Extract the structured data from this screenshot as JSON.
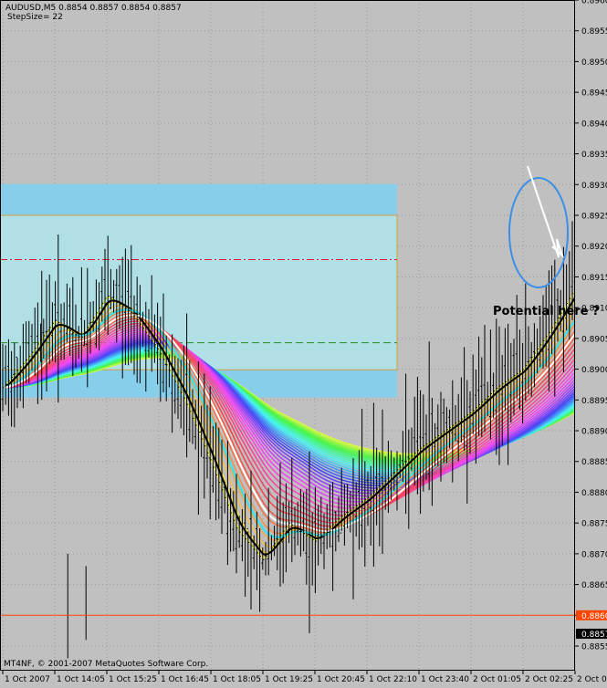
{
  "header": {
    "symbol_line": "AUDUSD,M5  0.8854 0.8857 0.8854 0.8857",
    "param_line": "StepSize= 22"
  },
  "footer": {
    "copyright": "MT4NF, © 2001-2007 MetaQuotes Software Corp."
  },
  "annotation": {
    "text": "Potential here ?"
  },
  "colors": {
    "background": "#c0c0c0",
    "grid": "#9a9a9a",
    "price_line": "#ff4500",
    "current_price_bg": "#000000",
    "zone_dark": "#87ceeb",
    "zone_light": "#b0e0e6",
    "zone_border": "#d2a040",
    "dashdot_line": "#dc143c",
    "dashed_line": "#228b22",
    "circle": "#3a8fe6",
    "ribbon_black": "#000000",
    "ribbon_cyan": "#40e0e8",
    "ribbon_white": "#ffffff"
  },
  "chart_data": {
    "type": "candlestick",
    "ylim": [
      0.8851,
      0.896
    ],
    "y_ticks": [
      "0.8960",
      "0.8955",
      "0.8950",
      "0.8945",
      "0.8940",
      "0.8935",
      "0.8930",
      "0.8925",
      "0.8920",
      "0.8915",
      "0.8910",
      "0.8905",
      "0.8900",
      "0.8895",
      "0.8890",
      "0.8885",
      "0.8880",
      "0.8875",
      "0.8870",
      "0.8865",
      "0.8860",
      "0.8855"
    ],
    "x_labels": [
      "1 Oct 2007",
      "1 Oct 14:05",
      "1 Oct 15:25",
      "1 Oct 16:45",
      "1 Oct 18:05",
      "1 Oct 19:25",
      "1 Oct 20:45",
      "1 Oct 22:10",
      "1 Oct 23:40",
      "2 Oct 01:05",
      "2 Oct 02:25",
      "2 Oct 03:45"
    ],
    "price_line_label": "0.8860",
    "current_price_label": "0.8857",
    "price_line_value": 0.886,
    "current_price_value": 0.8857,
    "zone_outer": [
      0.88954,
      0.89301
    ],
    "zone_inner": [
      0.88999,
      0.8925
    ],
    "dashdot_level": 0.89178,
    "dashed_level": 0.89043,
    "close_path": [
      [
        0,
        0.8897
      ],
      [
        0.5,
        0.8902
      ],
      [
        1,
        0.8908
      ],
      [
        1.5,
        0.8905
      ],
      [
        2,
        0.8912
      ],
      [
        2.5,
        0.8909
      ],
      [
        3,
        0.8903
      ],
      [
        3.5,
        0.8895
      ],
      [
        4,
        0.8885
      ],
      [
        4.5,
        0.8874
      ],
      [
        5,
        0.8869
      ],
      [
        5.5,
        0.8875
      ],
      [
        6,
        0.8872
      ],
      [
        6.5,
        0.8876
      ],
      [
        7,
        0.8879
      ],
      [
        7.5,
        0.8883
      ],
      [
        8,
        0.8887
      ],
      [
        8.5,
        0.889
      ],
      [
        9,
        0.8893
      ],
      [
        9.5,
        0.8897
      ],
      [
        10,
        0.89
      ],
      [
        10.5,
        0.8906
      ],
      [
        11,
        0.8913
      ],
      [
        11.5,
        0.892
      ],
      [
        12,
        0.8925
      ],
      [
        12.5,
        0.8927
      ],
      [
        13,
        0.8929
      ],
      [
        13.5,
        0.8931
      ],
      [
        14,
        0.8935
      ],
      [
        14.5,
        0.8938
      ],
      [
        15,
        0.8941
      ],
      [
        15.5,
        0.8943
      ],
      [
        16,
        0.8942
      ],
      [
        16.5,
        0.8941
      ],
      [
        17,
        0.8938
      ],
      [
        17.5,
        0.8939
      ],
      [
        18,
        0.8939
      ],
      [
        18.5,
        0.894
      ],
      [
        19,
        0.8938
      ],
      [
        19.5,
        0.894
      ],
      [
        20,
        0.894
      ],
      [
        20.5,
        0.8938
      ],
      [
        21,
        0.8937
      ],
      [
        21.5,
        0.8935
      ],
      [
        22,
        0.8936
      ],
      [
        22.5,
        0.893
      ],
      [
        23,
        0.8924
      ],
      [
        23.3,
        0.8923
      ]
    ]
  }
}
